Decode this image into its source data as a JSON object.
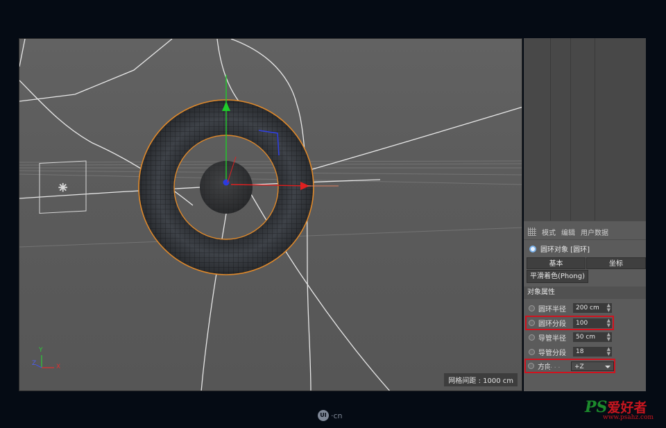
{
  "viewport": {
    "grid_spacing": "网格间距 : 1000 cm"
  },
  "axes": {
    "y": "Y",
    "z": "Z",
    "x": "X"
  },
  "attributes": {
    "menu": [
      "模式",
      "编辑",
      "用户数据"
    ],
    "object_title": "圆环对象 [圆环]",
    "tabs": [
      "基本",
      "坐标"
    ],
    "subtab": "平滑着色(Phong)",
    "section": "对象属性",
    "rows": [
      {
        "label": "圆环半径",
        "value": "200 cm"
      },
      {
        "label": "圆环分段",
        "value": "100"
      },
      {
        "label": "导管半径",
        "value": "50 cm"
      },
      {
        "label": "导管分段",
        "value": "18"
      }
    ],
    "direction": {
      "label": "方向",
      "dots": ". . .",
      "value": "+Z"
    }
  },
  "footer": {
    "logo": "UI",
    "logo_suffix": "·cn"
  },
  "watermark": {
    "ps": "PS",
    "cn": "爱好者",
    "url": "www.psahz.com"
  },
  "colors": {
    "highlight": "#d0131f",
    "selection": "#e0892a",
    "axis_y": "#1fcc2a",
    "axis_x": "#e02020",
    "axis_z": "#2a3be0"
  }
}
